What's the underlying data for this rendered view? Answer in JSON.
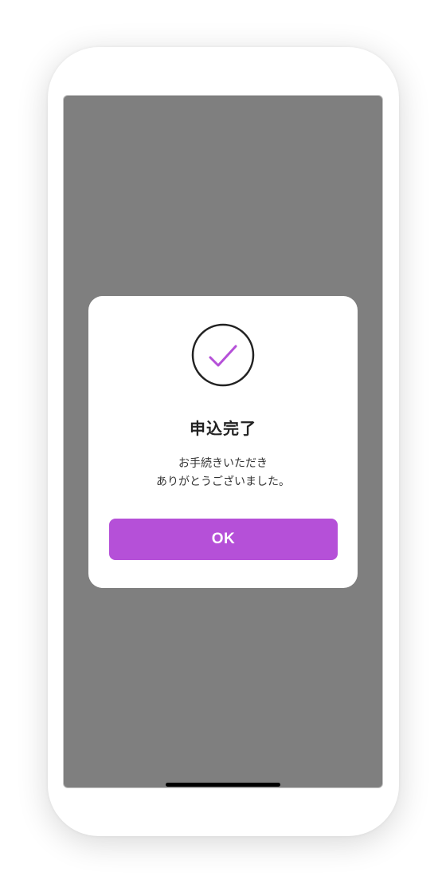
{
  "dialog": {
    "icon": "check-circle-icon",
    "title": "申込完了",
    "message_line1": "お手続きいただき",
    "message_line2": "ありがとうございました。",
    "ok_label": "OK"
  },
  "colors": {
    "accent": "#b550d8",
    "overlay": "#7f7f7f",
    "dialog_background": "#ffffff"
  }
}
